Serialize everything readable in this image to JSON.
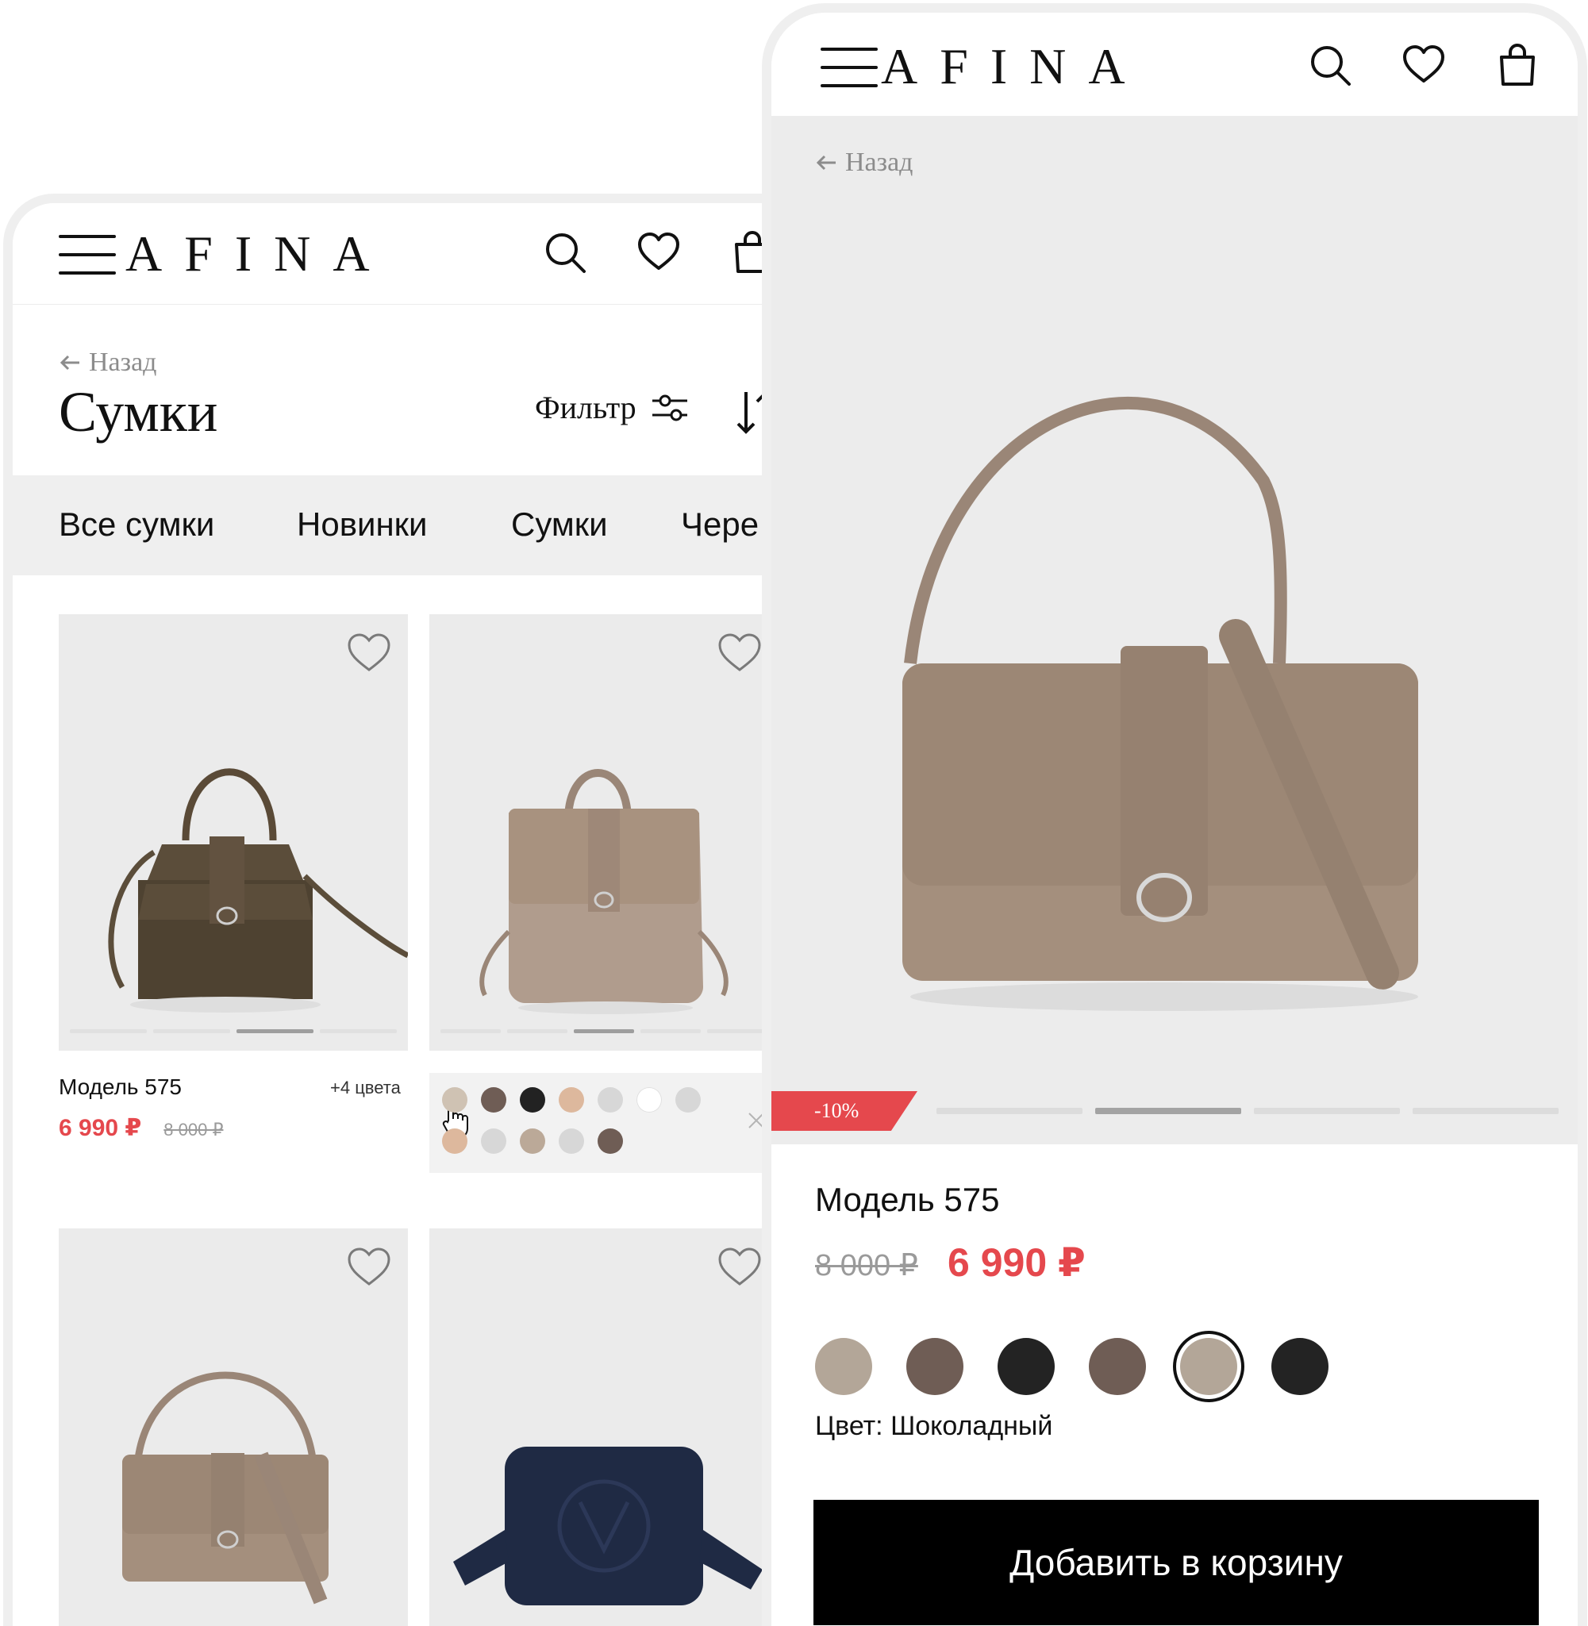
{
  "brand": "AFINA",
  "catalog": {
    "back_label": "Назад",
    "title": "Сумки",
    "filter_label": "Фильтр",
    "categories": [
      "Все сумки",
      "Новинки",
      "Сумки",
      "Чере"
    ],
    "products": [
      {
        "name": "Модель 575",
        "colors_badge": "+4 цвета",
        "price": "6 990 ₽",
        "old_price": "8 000 ₽"
      }
    ],
    "swatch_panel": {
      "row1": [
        "#cfc2b3",
        "#6f5d55",
        "#222222",
        "#ddb89d",
        "#d7d7d7",
        "#ffffff",
        "#d7d7d7"
      ],
      "row2": [
        "#ddb89d",
        "#d7d7d7",
        "#bba998",
        "#d7d7d7",
        "#6f5d55"
      ]
    }
  },
  "product": {
    "back_label": "Назад",
    "discount": "-10%",
    "name": "Модель 575",
    "old_price": "8 000 ₽",
    "price": "6 990 ₽",
    "swatches": [
      "#b3a698",
      "#6f5d55",
      "#232323",
      "#6f5d55",
      "#b3a698",
      "#232323"
    ],
    "selected_swatch": 4,
    "color_label": "Цвет: Шоколадный",
    "add_to_cart": "Добавить в корзину"
  },
  "colors": {
    "accent_red": "#e5484d",
    "bag_taupe": "#a48f7d",
    "bag_olive": "#5b4d3a",
    "bag_navy": "#1f2a44"
  }
}
